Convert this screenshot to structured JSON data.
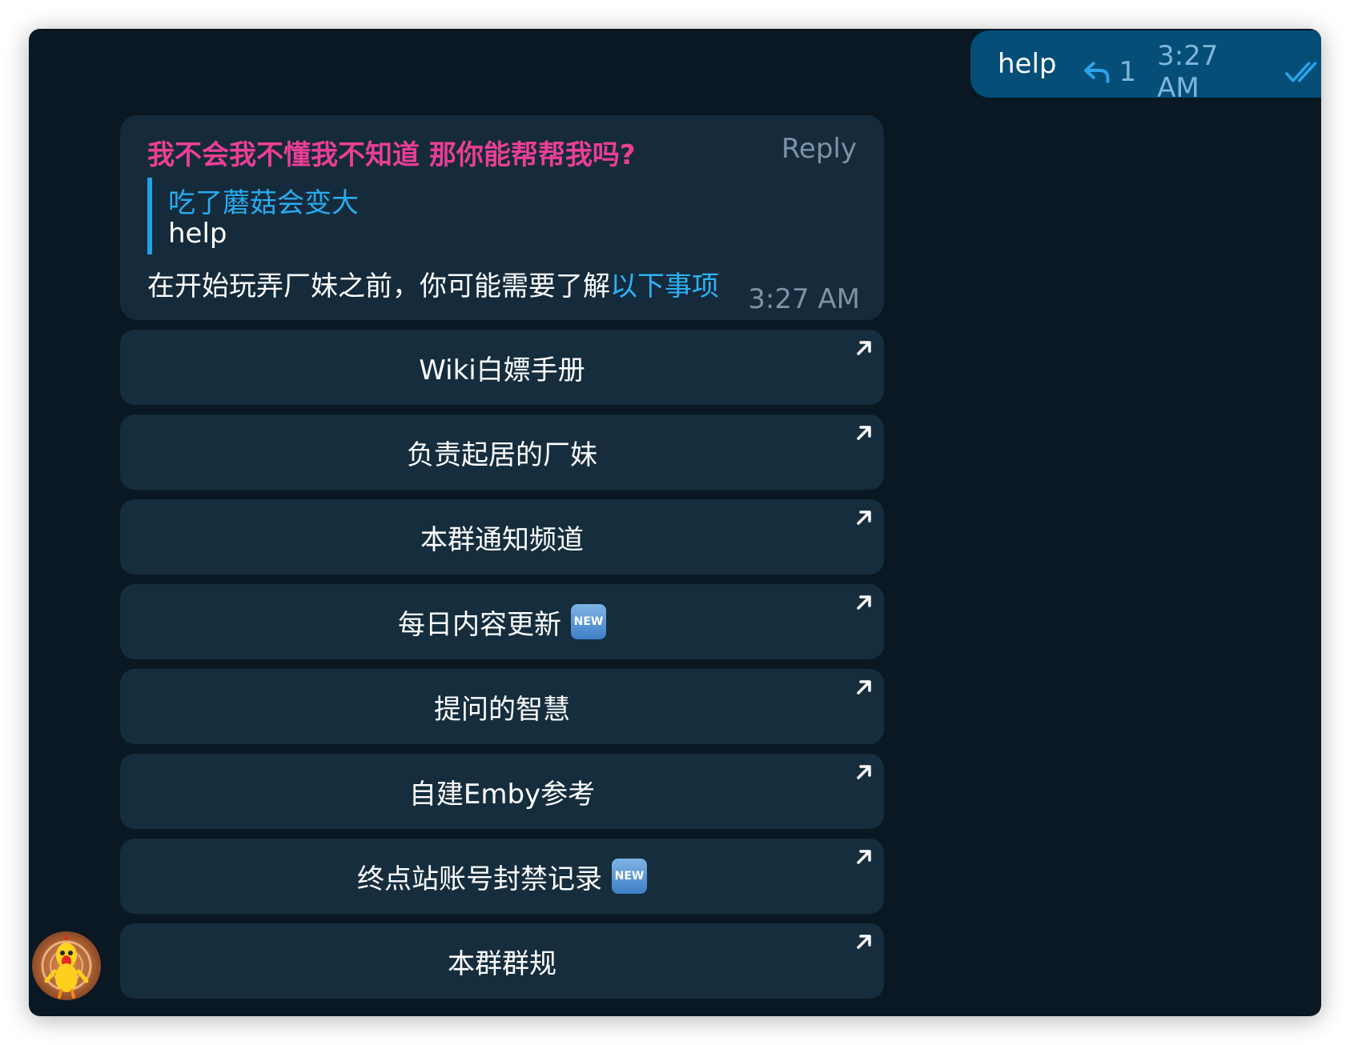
{
  "outgoing": {
    "text": "help",
    "reply_count": "1",
    "time": "3:27 AM",
    "status_icon": "double-check-icon"
  },
  "incoming": {
    "sender": "我不会我不懂我不知道 那你能帮帮我吗?",
    "reply_label": "Reply",
    "quote_author": "吃了蘑菇会变大",
    "quote_text": "help",
    "text": "在开始玩弄厂妹之前，你可能需要了解",
    "link_text": "以下事项",
    "time": "3:27 AM"
  },
  "buttons": [
    {
      "label": "Wiki白嫖手册"
    },
    {
      "label": "负责起居的厂妹"
    },
    {
      "label": "本群通知频道"
    },
    {
      "label": "每日内容更新",
      "badge": "NEW"
    },
    {
      "label": "提问的智慧"
    },
    {
      "label": "自建Emby参考"
    },
    {
      "label": "终点站账号封禁记录",
      "badge": "NEW"
    },
    {
      "label": "本群群规"
    }
  ],
  "colors": {
    "background": "#0a1824",
    "outgoing_bubble": "#044e78",
    "incoming_bubble": "#152a3a",
    "sender_name": "#ea3f93",
    "link": "#2eb2f5"
  }
}
